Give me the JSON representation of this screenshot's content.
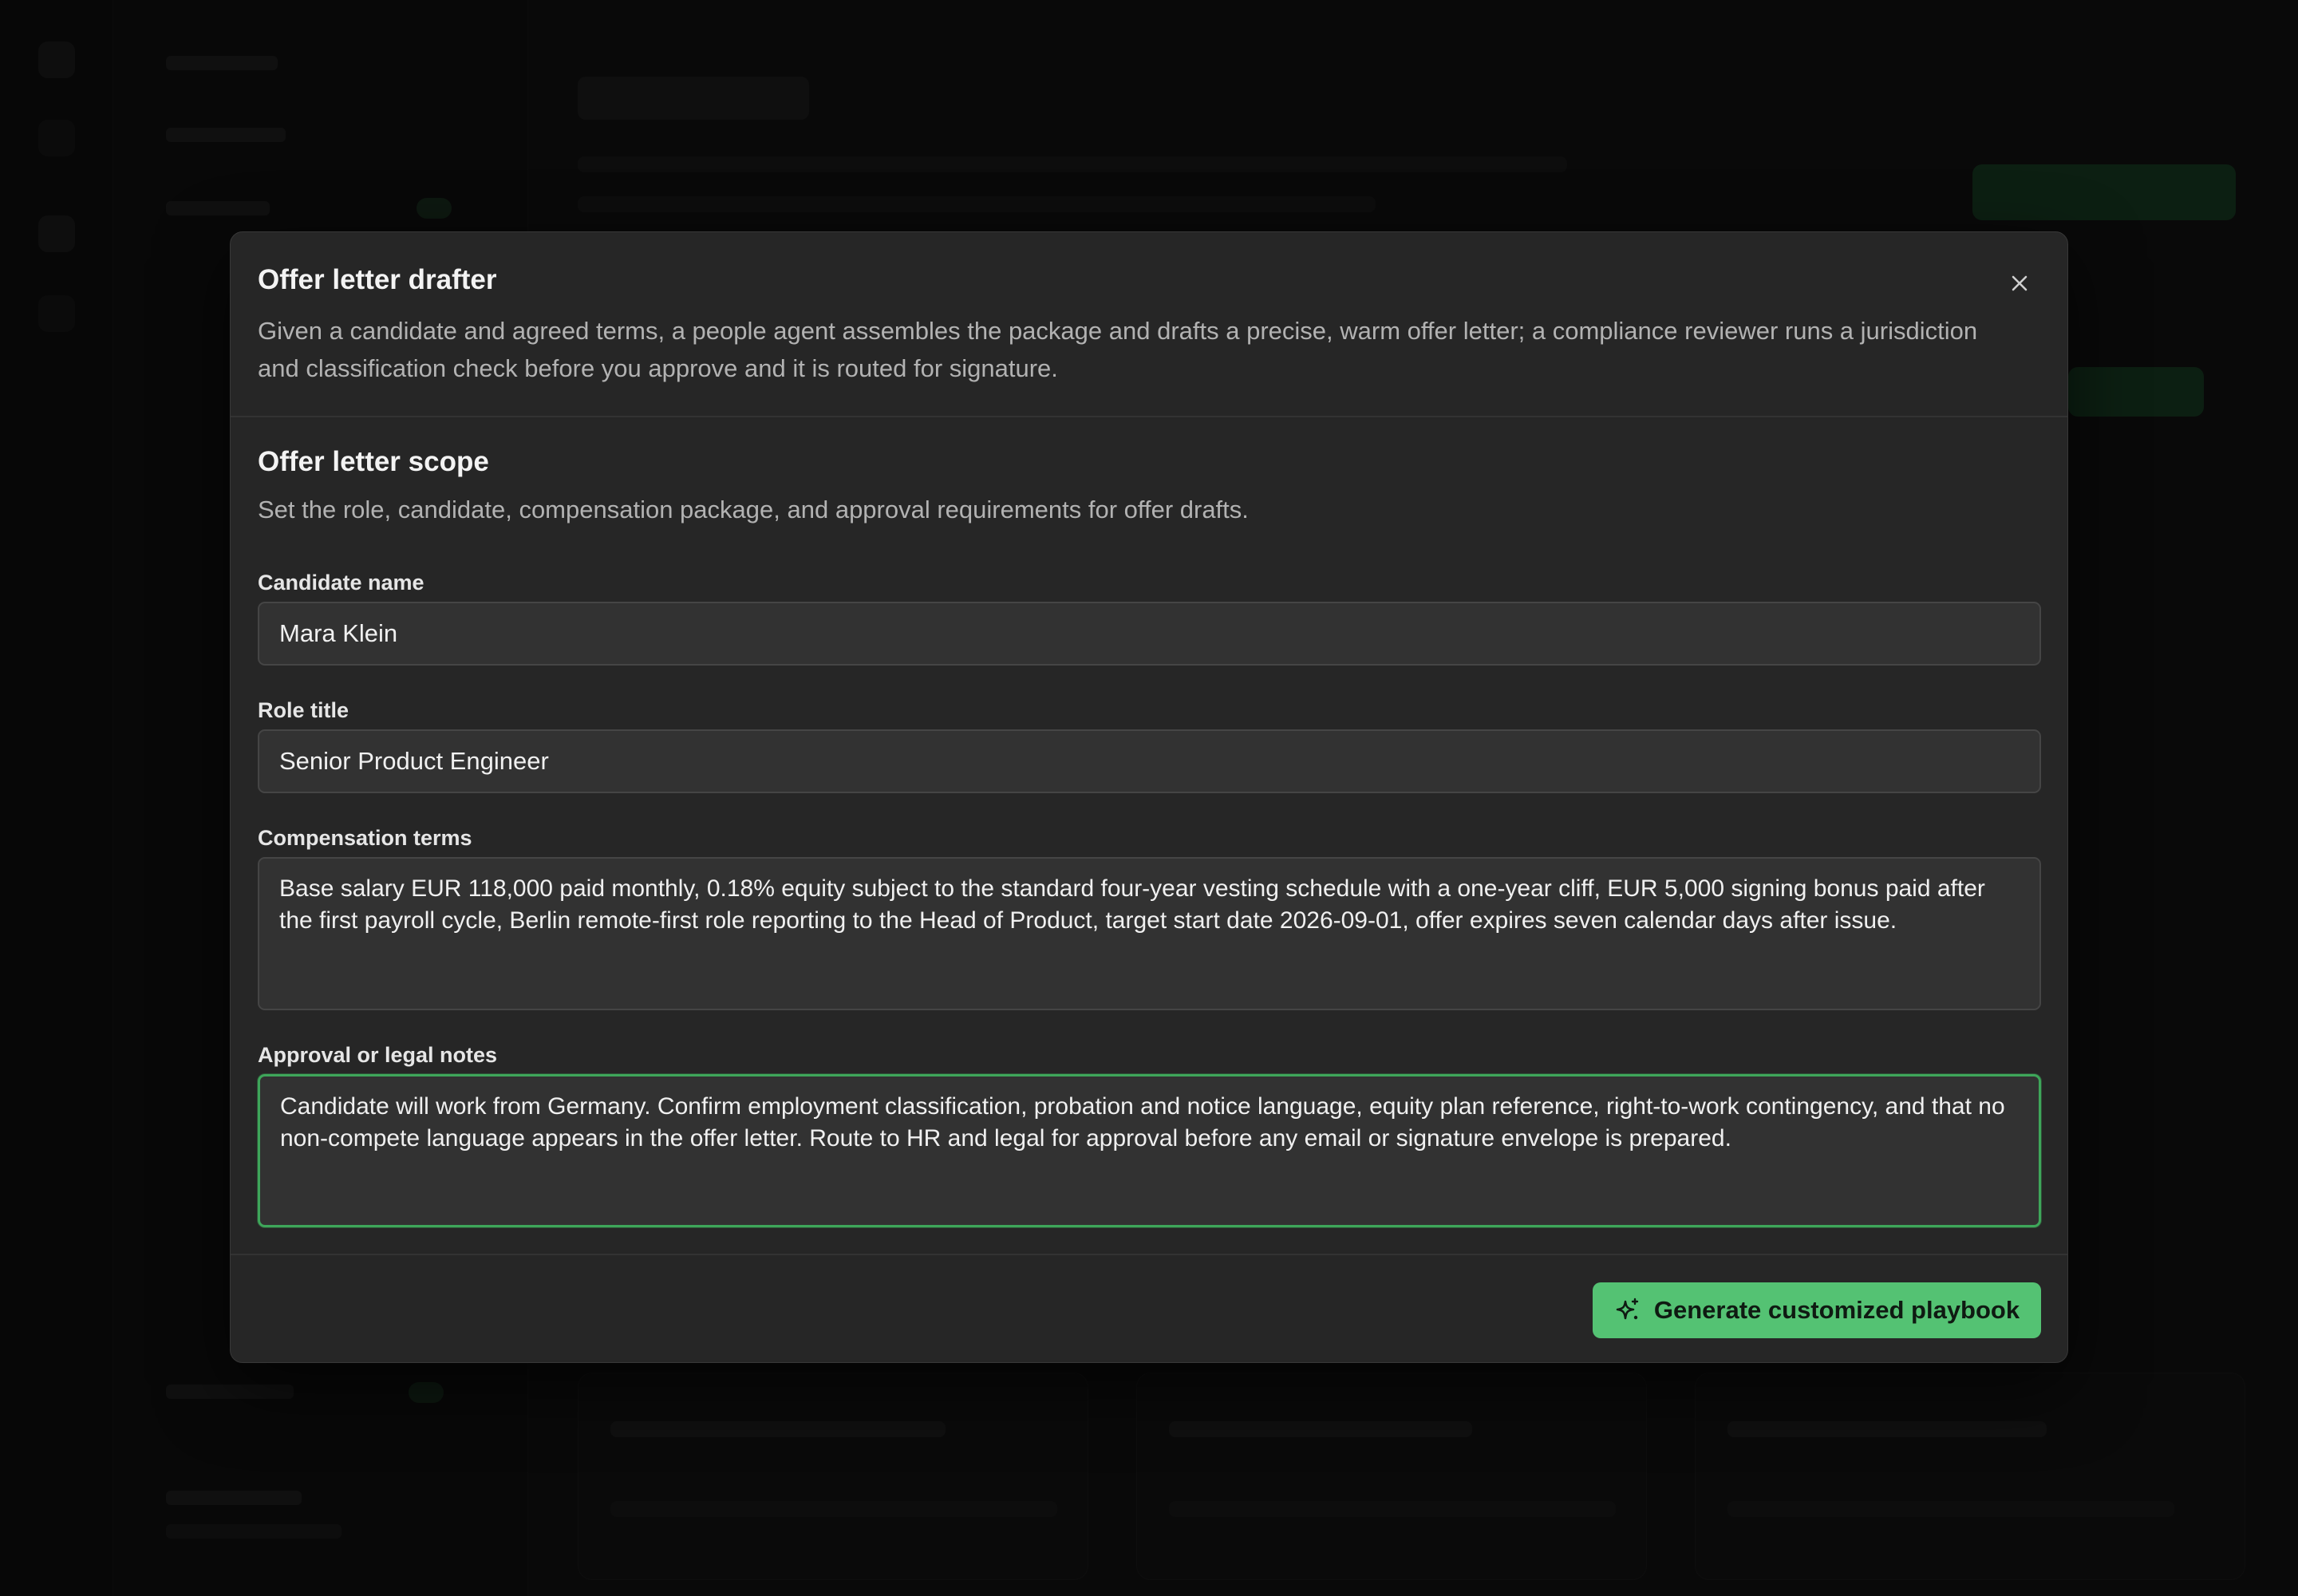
{
  "modal": {
    "title": "Offer letter drafter",
    "description": "Given a candidate and agreed terms, a people agent assembles the package and drafts a precise, warm offer letter; a compliance reviewer runs a jurisdiction and classification check before you approve and it is routed for signature.",
    "close_icon": "close-icon"
  },
  "scope": {
    "title": "Offer letter scope",
    "description": "Set the role, candidate, compensation package, and approval requirements for offer drafts."
  },
  "fields": {
    "candidate_name": {
      "label": "Candidate name",
      "value": "Mara Klein"
    },
    "role_title": {
      "label": "Role title",
      "value": "Senior Product Engineer"
    },
    "compensation_terms": {
      "label": "Compensation terms",
      "value": "Base salary EUR 118,000 paid monthly, 0.18% equity subject to the standard four-year vesting schedule with a one-year cliff, EUR 5,000 signing bonus paid after the first payroll cycle, Berlin remote-first role reporting to the Head of Product, target start date 2026-09-01, offer expires seven calendar days after issue."
    },
    "approval_notes": {
      "label": "Approval or legal notes",
      "value": "Candidate will work from Germany. Confirm employment classification, probation and notice language, equity plan reference, right-to-work contingency, and that no non-compete language appears in the offer letter. Route to HR and legal for approval before any email or signature envelope is prepared."
    }
  },
  "footer": {
    "generate_label": "Generate customized playbook",
    "generate_icon": "sparkle-icon"
  },
  "colors": {
    "accent": "#54c273",
    "focus_ring": "#3ea65a",
    "modal_bg": "#262626"
  }
}
